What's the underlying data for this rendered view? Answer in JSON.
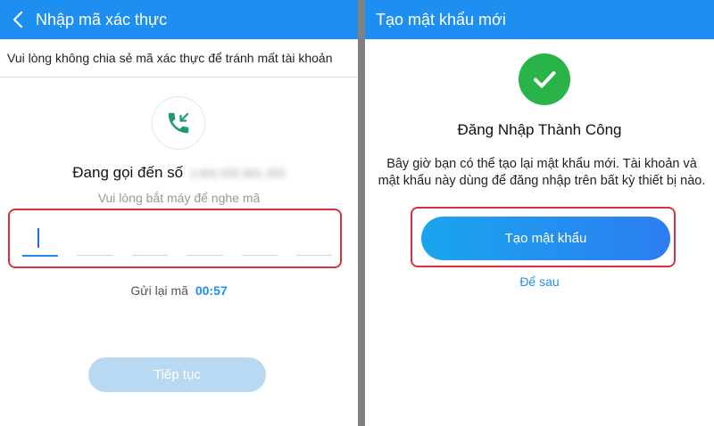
{
  "left": {
    "header": {
      "title": "Nhập mã xác thực",
      "back_icon": "chevron-left-icon"
    },
    "notice": "Vui lòng không chia sẻ mã xác thực để tránh mất tài khoản",
    "phone_icon": "incoming-call-icon",
    "calling_label": "Đang gọi đến số",
    "calling_number": "(+84) 935 801 255",
    "hint": "Vui lòng bắt máy để nghe mã",
    "otp": {
      "length": 6,
      "active_index": 0,
      "value": ""
    },
    "resend": {
      "label": "Gửi lại mã",
      "timer": "00:57"
    },
    "continue_label": "Tiếp tục"
  },
  "right": {
    "header": {
      "title": "Tạo mật khẩu mới"
    },
    "success_icon": "check-icon",
    "success_title": "Đăng Nhập Thành Công",
    "description": "Bây giờ bạn có thể tạo lại mật khẩu mới. Tài khoản và mật khẩu này dùng để đăng nhập trên bất kỳ thiết bị nào.",
    "create_button": "Tạo mật khẩu",
    "later_link": "Để sau"
  },
  "colors": {
    "header": "#1f8ef1",
    "accent": "#1f8ef1",
    "highlight": "#d9323f",
    "success": "#28b448",
    "disabled_button": "#b9d8f1"
  }
}
